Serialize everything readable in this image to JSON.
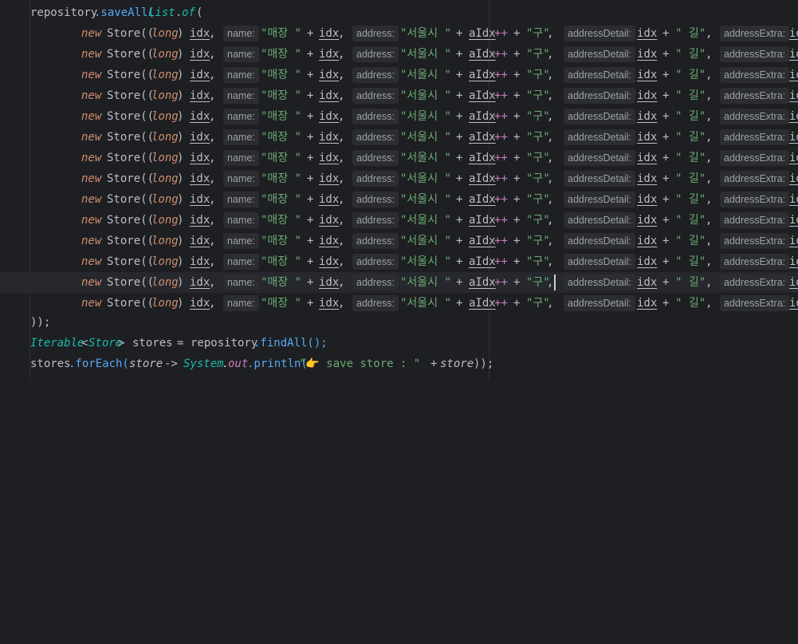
{
  "editor": {
    "lines": {
      "open": {
        "receiver": "repository",
        "method": ".saveAll(",
        "arg_class": "List",
        "arg_dot": ".",
        "arg_method": "of",
        "paren": "("
      },
      "store_row": {
        "kw_new": "new",
        "ctor": "Store((",
        "cast": "long",
        "cast_close": ")",
        "idx": "idx",
        "comma": ",",
        "hint_name": "name:",
        "str_name": "\"매장 \"",
        "plus": "+",
        "hint_address": "address:",
        "str_address": "\"서울시 \"",
        "aidx": "aIdx",
        "incr": "++",
        "str_gu": "\"구\"",
        "hint_detail": "addressDetail:",
        "str_gil": "\" 길\"",
        "hint_extra": "addressExtra:",
        "cut": "id"
      },
      "close": "));",
      "iterable": {
        "type": "Iterable",
        "generic_open": "<",
        "generic": "Store",
        "generic_close": ">",
        "var": "stores",
        "assign": "=",
        "receiver": "repository",
        "call": ".findAll();"
      },
      "foreach": {
        "receiver": "stores",
        "method": ".forEach(",
        "param": "store",
        "arrow": "->",
        "sys": "System",
        "dot1": ".",
        "out": "out",
        "println": ".println(",
        "str": "\"👉 save store : \"",
        "plus": "+",
        "param2": "store",
        "close": "));"
      }
    },
    "store_row_count": 14,
    "current_line_index": 12,
    "colors": {
      "background": "#1e1f22",
      "current_line": "#26282e",
      "keyword": "#cf8e6d",
      "string": "#6aab73",
      "function": "#56a8f5",
      "type_param": "#16baac",
      "field": "#c77dbb",
      "hint_bg": "#2b2d30"
    }
  }
}
